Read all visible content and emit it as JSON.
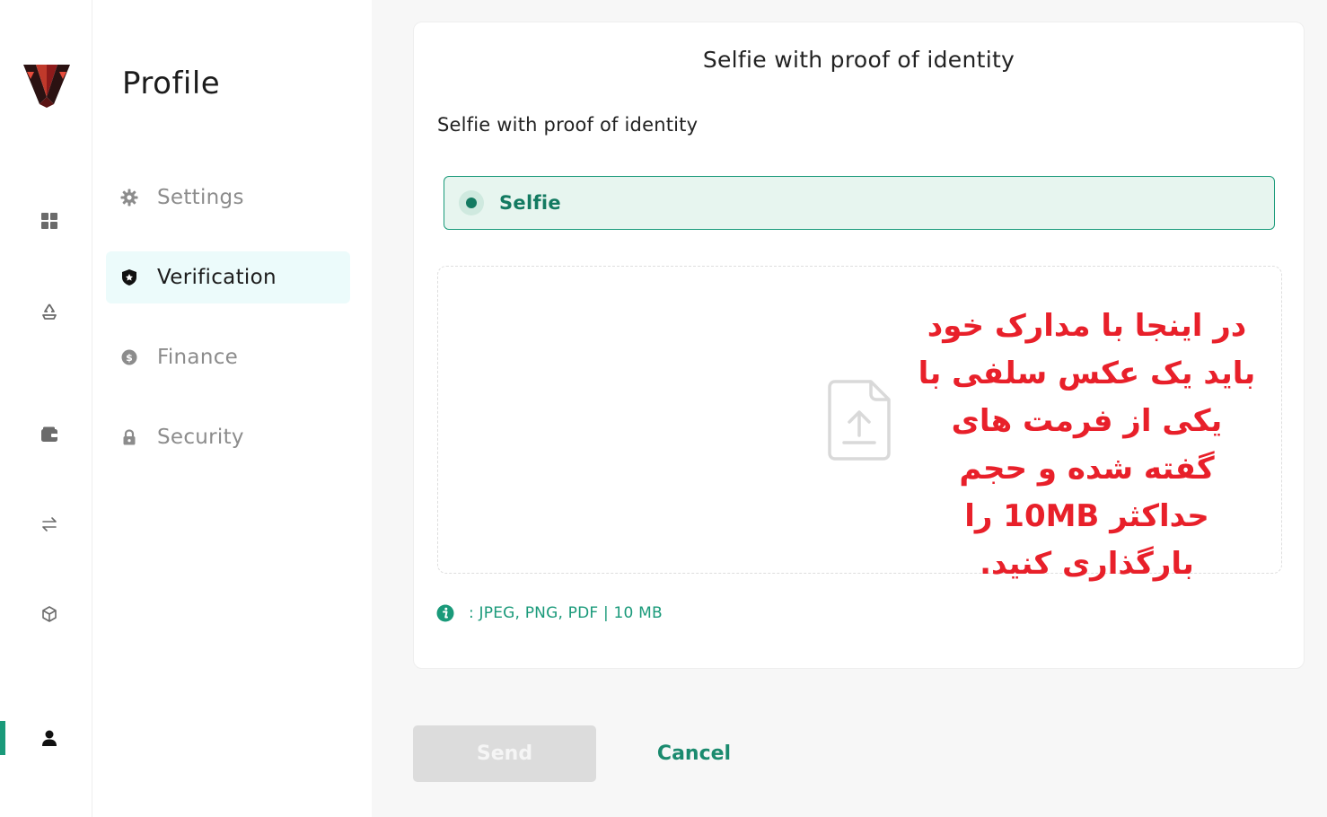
{
  "sidebar": {
    "title": "Profile",
    "items": [
      {
        "label": "Settings",
        "icon": "gear-icon"
      },
      {
        "label": "Verification",
        "icon": "shield-icon",
        "active": true
      },
      {
        "label": "Finance",
        "icon": "coin-icon"
      },
      {
        "label": "Security",
        "icon": "lock-icon"
      }
    ]
  },
  "rail": {
    "icons": [
      "logo",
      "dashboard-icon",
      "recycle-icon",
      "wallet-icon",
      "exchange-icon",
      "cube-icon",
      "user-icon"
    ],
    "active": "user-icon"
  },
  "card": {
    "title": "Selfie with proof of identity",
    "section_label": "Selfie with proof of identity",
    "option_label": "Selfie",
    "option_selected": true,
    "annotation": "در اینجا با مدارک خود باید یک عکس سلفی با یکی از فرمت های گفته شده و حجم حداکثر 10MB را بارگذاری کنید.",
    "info_text": ": JPEG, PNG, PDF | 10 MB"
  },
  "actions": {
    "send_label": "Send",
    "send_disabled": true,
    "cancel_label": "Cancel"
  },
  "colors": {
    "accent": "#1a9a7a",
    "accent_dark": "#137a61",
    "annotation": "#e8202a",
    "active_bg": "#ecfbfb"
  }
}
